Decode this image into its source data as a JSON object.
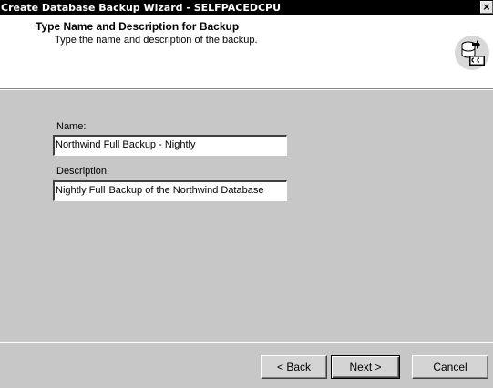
{
  "window": {
    "title": "Create Database Backup Wizard - SELFPACEDCPU",
    "close_glyph": "×"
  },
  "header": {
    "title": "Type Name and Description for Backup",
    "subtitle": "Type the name and description of the backup.",
    "icon": "database-backup-wizard-icon"
  },
  "form": {
    "name_label": "Name:",
    "name_value": "Northwind Full Backup - Nightly",
    "description_label": "Description:",
    "description_value_before_caret": "Nightly Full ",
    "description_value_after_caret": "Backup of the Northwind Database"
  },
  "buttons": {
    "back": "< Back",
    "next": "Next >",
    "cancel": "Cancel"
  },
  "colors": {
    "titlebar": "#000000",
    "body": "#c7c7c7",
    "header": "#ffffff"
  }
}
